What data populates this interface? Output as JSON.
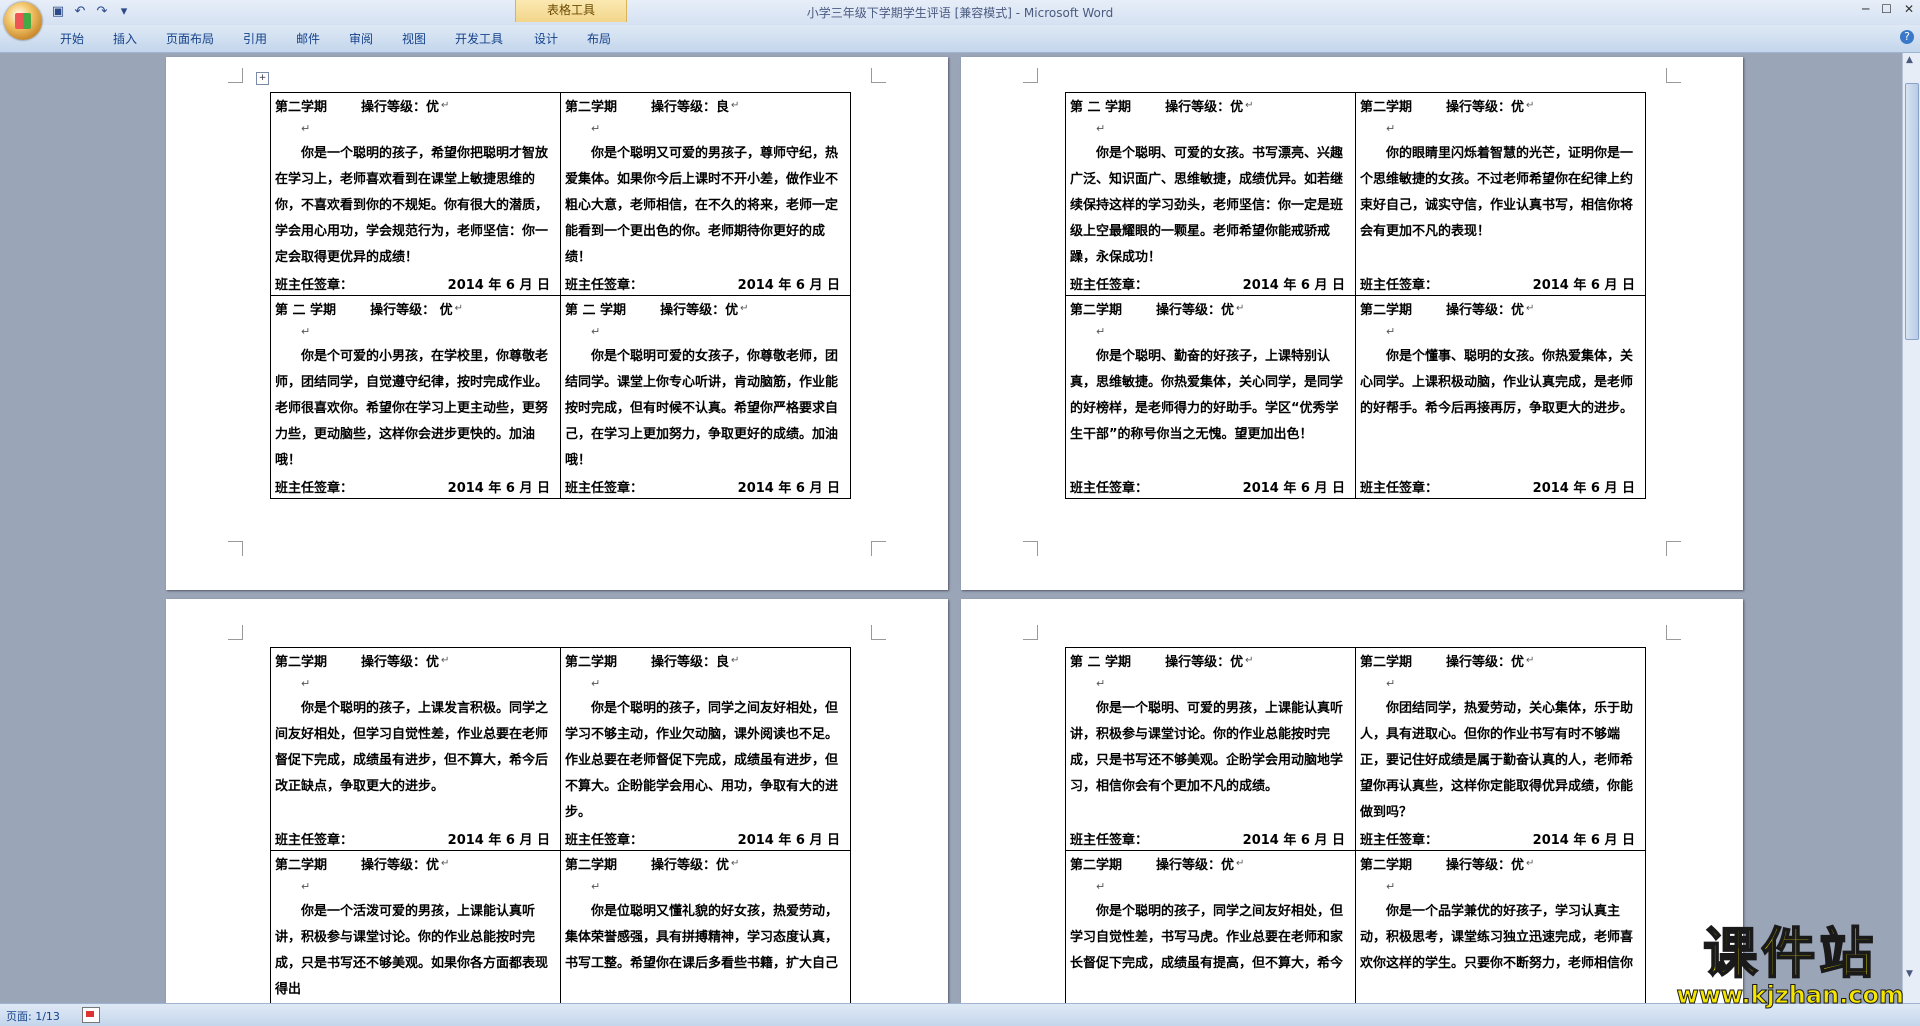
{
  "window": {
    "title": "小学三年级下学期学生评语 [兼容模式] - Microsoft Word",
    "context_tab_group": "表格工具"
  },
  "ribbon": {
    "tabs": [
      "开始",
      "插入",
      "页面布局",
      "引用",
      "邮件",
      "审阅",
      "视图",
      "开发工具",
      "设计",
      "布局"
    ]
  },
  "status": {
    "page": "页面: 1/13"
  },
  "watermark": {
    "line1": "课件站",
    "line2": "www.kjzhan.com"
  },
  "labels": {
    "signature": "班主任签章：",
    "date": "2014 年 6 月  日"
  },
  "pages": [
    {
      "cards": [
        {
          "semester": "第二学期",
          "grade": "操行等级：优",
          "comment": "你是一个聪明的孩子，希望你把聪明才智放在学习上，老师喜欢看到在课堂上敏捷思维的你，不喜欢看到你的不规矩。你有很大的潜质，学会用心用功，学会规范行为，老师坚信：你一定会取得更优异的成绩！"
        },
        {
          "semester": "第二学期",
          "grade": "操行等级：良",
          "comment": "你是个聪明又可爱的男孩子，尊师守纪，热爱集体。如果你今后上课时不开小差，做作业不粗心大意，老师相信，在不久的将来，老师一定能看到一个更出色的你。老师期待你更好的成绩！"
        },
        {
          "semester": "第 二 学期",
          "grade": "操行等级： 优",
          "comment": "你是个可爱的小男孩，在学校里，你尊敬老师，团结同学，自觉遵守纪律，按时完成作业。老师很喜欢你。希望你在学习上更主动些，更努力些，更动脑些，这样你会进步更快的。加油哦！"
        },
        {
          "semester": "第 二 学期",
          "grade": "操行等级：优",
          "comment": "你是个聪明可爱的女孩子，你尊敬老师，团结同学。课堂上你专心听讲，肯动脑筋，作业能按时完成，但有时候不认真。希望你严格要求自己，在学习上更加努力，争取更好的成绩。加油哦！"
        }
      ]
    },
    {
      "cards": [
        {
          "semester": "第 二 学期",
          "grade": "操行等级：优",
          "comment": "你是个聪明、可爱的女孩。书写漂亮、兴趣广泛、知识面广、思维敏捷，成绩优异。如若继续保持这样的学习劲头，老师坚信：你一定是班级上空最耀眼的一颗星。老师希望你能戒骄戒躁，永保成功！"
        },
        {
          "semester": "第二学期",
          "grade": "操行等级：优",
          "comment": "你的眼睛里闪烁着智慧的光芒，证明你是一个思维敏捷的女孩。不过老师希望你在纪律上约束好自己，诚实守信，作业认真书写，相信你将会有更加不凡的表现！"
        },
        {
          "semester": "第二学期",
          "grade": "操行等级：优",
          "comment": "你是个聪明、勤奋的好孩子，上课特别认真，思维敏捷。你热爱集体，关心同学，是同学的好榜样，是老师得力的好助手。学区“优秀学生干部”的称号你当之无愧。望更加出色！"
        },
        {
          "semester": "第二学期",
          "grade": "操行等级：优",
          "comment": "你是个懂事、聪明的女孩。你热爱集体，关心同学。上课积极动脑，作业认真完成，是老师的好帮手。希今后再接再厉，争取更大的进步。"
        }
      ]
    },
    {
      "cards": [
        {
          "semester": "第二学期",
          "grade": "操行等级：优",
          "comment": "你是个聪明的孩子，上课发言积极。同学之间友好相处，但学习自觉性差，作业总要在老师督促下完成，成绩虽有进步，但不算大，希今后改正缺点，争取更大的进步。"
        },
        {
          "semester": "第二学期",
          "grade": "操行等级：良",
          "comment": "你是个聪明的孩子，同学之间友好相处，但学习不够主动，作业欠动脑，课外阅读也不足。作业总要在老师督促下完成，成绩虽有进步，但不算大。企盼能学会用心、用功，争取有大的进步。"
        },
        {
          "semester": "第二学期",
          "grade": "操行等级：优",
          "comment": "你是一个活泼可爱的男孩，上课能认真听讲，积极参与课堂讨论。你的作业总能按时完成，只是书写还不够美观。如果你各方面都表现得出"
        },
        {
          "semester": "第二学期",
          "grade": "操行等级：优",
          "comment": "你是位聪明又懂礼貌的好女孩，热爱劳动，集体荣誉感强，具有拼搏精神，学习态度认真，书写工整。希望你在课后多看些书籍，扩大自己"
        }
      ]
    },
    {
      "cards": [
        {
          "semester": "第 二 学期",
          "grade": "操行等级：优",
          "comment": "你是一个聪明、可爱的男孩，上课能认真听讲，积极参与课堂讨论。你的作业总能按时完成，只是书写还不够美观。企盼学会用动脑地学习，相信你会有个更加不凡的成绩。"
        },
        {
          "semester": "第二学期",
          "grade": "操行等级：优",
          "comment": "你团结同学，热爱劳动，关心集体，乐于助人，具有进取心。但你的作业书写有时不够端正，要记住好成绩是属于勤奋认真的人，老师希望你再认真些，这样你定能取得优异成绩，你能做到吗？"
        },
        {
          "semester": "第二学期",
          "grade": "操行等级：优",
          "comment": "你是个聪明的孩子，同学之间友好相处，但学习自觉性差，书写马虎。作业总要在老师和家长督促下完成，成绩虽有提高，但不算大，希今"
        },
        {
          "semester": "第二学期",
          "grade": "操行等级：优",
          "comment": "你是一个品学兼优的好孩子，学习认真主动，积极思考，课堂练习独立迅速完成，老师喜欢你这样的学生。只要你不断努力，老师相信你"
        }
      ]
    }
  ]
}
